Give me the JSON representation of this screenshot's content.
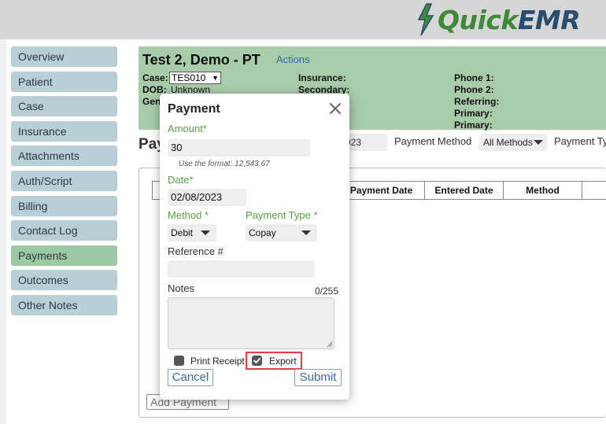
{
  "app": {
    "logo_part1": "Quick",
    "logo_part2": "EMR"
  },
  "sidebar": {
    "items": [
      {
        "label": "Overview"
      },
      {
        "label": "Patient"
      },
      {
        "label": "Case"
      },
      {
        "label": "Insurance"
      },
      {
        "label": "Attachments"
      },
      {
        "label": "Auth/Script"
      },
      {
        "label": "Billing"
      },
      {
        "label": "Contact Log"
      },
      {
        "label": "Payments",
        "active": true
      },
      {
        "label": "Outcomes"
      },
      {
        "label": "Other Notes"
      }
    ]
  },
  "patient_header": {
    "name": "Test 2, Demo - PT",
    "actions_label": "Actions",
    "case_label": "Case:",
    "case_value": "TES010",
    "dob_label": "DOB:",
    "dob_value": "Unknown",
    "gender_label_partial": "Gen",
    "insurance_label": "Insurance:",
    "secondary_label": "Secondary:",
    "phone1_label": "Phone 1:",
    "phone2_label": "Phone 2:",
    "referring_label": "Referring:",
    "primary_label_1": "Primary:",
    "primary_label_2": "Primary:"
  },
  "page": {
    "title_partial": "Pay"
  },
  "filters": {
    "date_partial": "023",
    "payment_method_label": "Payment Method",
    "payment_method_value": "All Methods",
    "payment_type_label_partial": "Payment Typ"
  },
  "table": {
    "columns": [
      "Payment Date",
      "Entered Date",
      "Method"
    ]
  },
  "add_payment_label": "Add Payment",
  "modal": {
    "title": "Payment",
    "amount_label": "Amount*",
    "amount_value": "30",
    "amount_hint": "Use the format: 12,543.67",
    "date_label": "Date*",
    "date_value": "02/08/2023",
    "method_label": "Method *",
    "method_value": "Debit",
    "payment_type_label": "Payment Type *",
    "payment_type_value": "Copay",
    "reference_label": "Reference #",
    "reference_value": "",
    "notes_label": "Notes",
    "notes_counter": "0/255",
    "print_receipt_label": "Print Receipt",
    "print_receipt_checked": false,
    "export_label": "Export",
    "export_checked": true,
    "cancel_label": "Cancel",
    "submit_label": "Submit"
  },
  "colors": {
    "accent_green": "#5c9c4a",
    "header_green": "#a8ccaa",
    "nav_blue": "#b9cfd6",
    "nav_active": "#9cc8a3",
    "highlight_red": "#e04040",
    "link_blue": "#2f6db0"
  }
}
